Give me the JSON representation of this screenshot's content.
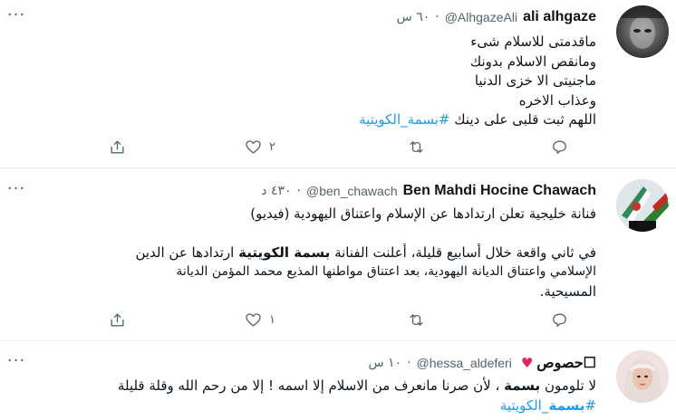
{
  "tweets": [
    {
      "name": "ali alhgaze",
      "handle": "@AlhgazeAli",
      "dot": "·",
      "time": "٦٠ س",
      "lines": [
        "ماقدمتى للاسلام شىء",
        "ومانقص الاسلام بدونك",
        "ماجنيتى الا خزى الدنيا",
        "وعذاب الاخره"
      ],
      "last_line_text": "اللهم ثبت قلبى على دينك",
      "hashtag": "#بسمة_الكويتية",
      "like_count": "٢",
      "more": "···"
    },
    {
      "name": "Ben Mahdi Hocine Chawach",
      "handle": "@ben_chawach",
      "dot": "·",
      "time": "٤٣٠ د",
      "line1": "فنانة خليجية تعلن ارتدادها عن الإسلام واعتناق اليهودية (فيديو)",
      "line2_pre": "في ثاني واقعة خلال أسابيع قليلة، أعلنت الفنانة",
      "line2_bold": "بسمة الكويتية",
      "line2_post": "ارتدادها عن الدين",
      "line3": "الإسلامي واعتناق الديانة اليهودية، بعد اعتناق مواطنها المذيع محمد المؤمن الديانة",
      "line4": "المسيحية.",
      "like_count": "١",
      "more": "···"
    },
    {
      "name": "حصوص",
      "name_box": "☐",
      "heart": "♥",
      "handle": "@hessa_aldeferi",
      "dot": "·",
      "time": "١٠ س",
      "line1_pre": "لا تلومون",
      "line1_bold": "بسمة",
      "line1_post": "، لأن صرنا مانعرف من الاسلام إلا اسمه ! إلا من رحم الله وقلة قليلة",
      "hashtag_pre": "#",
      "hashtag_bold": "بسمة",
      "hashtag_post": "_الكويتية",
      "more": "···"
    }
  ],
  "icons": [
    "reply-icon",
    "retweet-icon",
    "like-icon",
    "share-icon"
  ]
}
